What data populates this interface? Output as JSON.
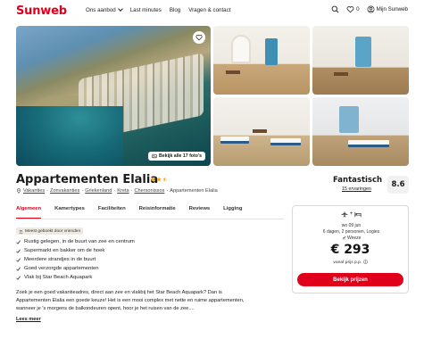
{
  "header": {
    "logo": "Sunweb",
    "nav": [
      "Ons aanbod",
      "Last minutes",
      "Blog",
      "Vragen & contact"
    ],
    "favorites_count": "0",
    "account_label": "Mijn Sunweb"
  },
  "gallery": {
    "all_photos_label": "Bekijk alle 17 foto's"
  },
  "hotel": {
    "name": "Appartementen Elalia",
    "stars": 2.5,
    "breadcrumbs": [
      "Vakanties",
      "Zonvakanties",
      "Griekenland",
      "Kreta",
      "Chersonissos"
    ],
    "breadcrumb_current": "Appartementen Elalia",
    "rating_word": "Fantastisch",
    "reviews_label": "15 ervaringen",
    "score": "8.6"
  },
  "tabs": [
    "Algemeen",
    "Kamertypes",
    "Faciliteiten",
    "Reisinformatie",
    "Reviews",
    "Ligging"
  ],
  "badge": "Meest geboekt door vrienden",
  "features": [
    "Rustig gelegen, in de buurt van zee en centrum",
    "Supermarkt en bakker om de hoek",
    "Meerdere strandjes in de buurt",
    "Goed verzorgde appartementen",
    "Vlak bij Star Beach Aquapark"
  ],
  "description": "Zoek je een goed vakantieadres, direct aan zee en vlakbij het Star Beach Aquapark? Dan is Appartementen Elalia een goede keuze! Het is een mooi complex met nette en ruime appartementen, wanneer je 's morgens de balkondeuren opent, hoor je het ruisen van de zee....",
  "read_more": "Lees meer",
  "booking": {
    "date": "wo 09 jun",
    "details": "6 dagen, 2 personen, Logies",
    "departure": "Weeze",
    "price": "€ 293",
    "price_note": "vanaf prijs p.p.",
    "button_label": "Bekijk prijzen"
  },
  "colors": {
    "brand": "#e0001b",
    "star": "#f5a623"
  }
}
